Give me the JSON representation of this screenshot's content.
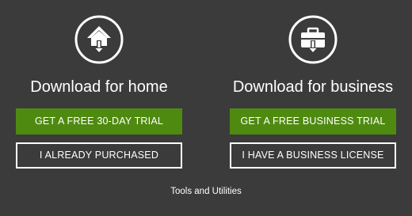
{
  "home": {
    "icon": "house-download-icon",
    "title": "Download for home",
    "primary_button": "GET A FREE 30-DAY TRIAL",
    "secondary_button": "I ALREADY PURCHASED"
  },
  "business": {
    "icon": "briefcase-download-icon",
    "title": "Download for business",
    "primary_button": "GET A FREE BUSINESS TRIAL",
    "secondary_button": "I HAVE A BUSINESS LICENSE"
  },
  "footer": {
    "link": "Tools and Utilities"
  },
  "colors": {
    "background": "#3b3b3b",
    "primary_button": "#4f8a10",
    "text": "#ffffff"
  }
}
